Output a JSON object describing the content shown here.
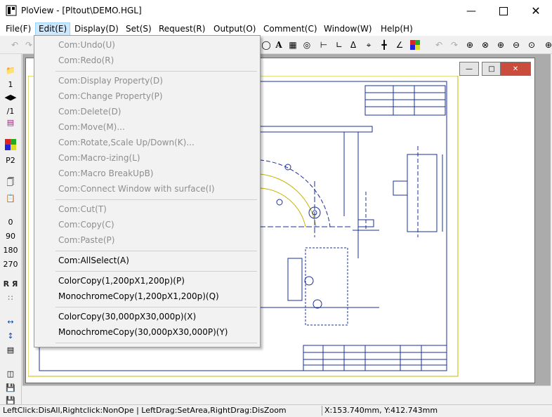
{
  "window": {
    "title": "PloView - [Pltout\\DEMO.HGL]"
  },
  "menubar": {
    "items": [
      {
        "label": "File(F)"
      },
      {
        "label": "Edit(E)"
      },
      {
        "label": "Display(D)"
      },
      {
        "label": "Set(S)"
      },
      {
        "label": "Request(R)"
      },
      {
        "label": "Output(O)"
      },
      {
        "label": "Comment(C)"
      },
      {
        "label": "Window(W)"
      },
      {
        "label": "Help(H)"
      }
    ],
    "active": "Edit(E)"
  },
  "edit_menu": {
    "items": [
      {
        "label": "Com:Undo(U)",
        "enabled": false
      },
      {
        "label": "Com:Redo(R)",
        "enabled": false
      },
      {
        "label": "Com:Display Property(D)",
        "enabled": false
      },
      {
        "label": "Com:Change Property(P)",
        "enabled": false
      },
      {
        "label": "Com:Delete(D)",
        "enabled": false
      },
      {
        "label": "Com:Move(M)...",
        "enabled": false
      },
      {
        "label": "Com:Rotate,Scale Up/Down(K)...",
        "enabled": false
      },
      {
        "label": "Com:Macro-izing(L)",
        "enabled": false
      },
      {
        "label": "Com:Macro BreakUpB)",
        "enabled": false
      },
      {
        "label": "Com:Connect Window with surface(I)",
        "enabled": false
      },
      {
        "label": "Com:Cut(T)",
        "enabled": false
      },
      {
        "label": "Com:Copy(C)",
        "enabled": false
      },
      {
        "label": "Com:Paste(P)",
        "enabled": false
      },
      {
        "label": "Com:AllSelect(A)",
        "enabled": true
      },
      {
        "label": "ColorCopy(1,200pX1,200p)(P)",
        "enabled": true
      },
      {
        "label": "MonochromeCopy(1,200pX1,200p)(Q)",
        "enabled": true
      },
      {
        "label": "ColorCopy(30,000pX30,000p)(X)",
        "enabled": true
      },
      {
        "label": "MonochromeCopy(30,000pX30,000P)(Y)",
        "enabled": true
      }
    ]
  },
  "leftbar": {
    "page_number": "1",
    "page_fraction": "/1",
    "pen_label": "P2",
    "rotation_values": [
      "0",
      "90",
      "180",
      "270"
    ],
    "mirror_label": "R Я"
  },
  "statusbar": {
    "left": "LeftClick:DisAll,Rightclick:NonOpe  |  LeftDrag:SetArea,RightDrag:DisZoom",
    "coords": "X:153.740mm, Y:412.743mm"
  },
  "colors": {
    "accent": "#cce8ff",
    "drawing_blue": "#1a2f9a",
    "drawing_yellow": "#c8b400",
    "close_red": "#c94c3c"
  }
}
